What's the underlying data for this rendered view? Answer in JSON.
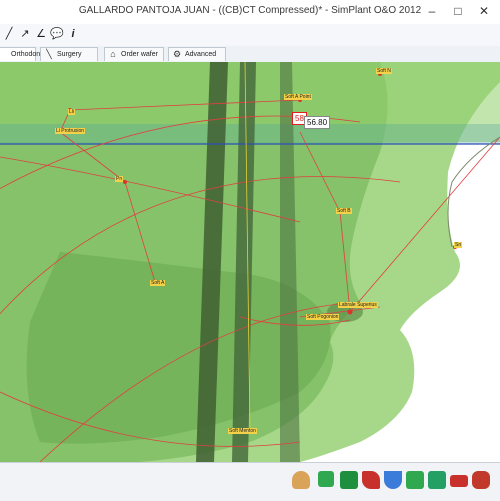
{
  "window": {
    "title": "GALLARDO PANTOJA JUAN -   ((CB)CT Compressed)* - SimPlant O&O 2012",
    "min_glyph": "–",
    "max_glyph": "□",
    "close_glyph": "✕"
  },
  "toolbar": {
    "icons": [
      "zoom-icon",
      "line-tool-icon",
      "angle-tool-icon",
      "comment-icon",
      "info-icon"
    ],
    "glyphs": [
      "╱",
      "↗",
      "∠",
      "💬",
      "i"
    ]
  },
  "tabs": [
    {
      "label": "Orthodontics",
      "icon": "orthodontics-icon",
      "glyph": "▣",
      "active": true
    },
    {
      "label": "Surgery",
      "icon": "scalpel-icon",
      "glyph": "╲",
      "active": false
    },
    {
      "label": "Order wafer",
      "icon": "cart-icon",
      "glyph": "⌂",
      "active": false
    },
    {
      "label": "Advanced",
      "icon": "gear-icon",
      "glyph": "⚙",
      "active": false
    }
  ],
  "viewport": {
    "measurement_top": "56.80",
    "measurement_red": "58",
    "landmarks": [
      "Lli",
      "Li Protrusion",
      "Soft B",
      "Soft Pogonion",
      "Soft Menton",
      "Soft N",
      "Soft A",
      "Pn",
      "Sn",
      "Soft A Point",
      "Labrale Superius"
    ]
  },
  "statusbar": {
    "icons": [
      "skull-view-icon",
      "soft-tissue-icon",
      "maxilla-icon",
      "mandible-icon",
      "dentition-icon",
      "teeth-upper-icon",
      "teeth-lower-icon",
      "nerve-icon",
      "jaw-icon"
    ],
    "colors": [
      "#d9a35a",
      "#2fa84f",
      "#1e8f3c",
      "#c8312b",
      "#3b7bd9",
      "#2fa84f",
      "#25a065",
      "#c8312b",
      "#c0392b"
    ]
  },
  "colors": {
    "soft_tissue": "#9fd47f",
    "bone": "#6fae55",
    "measure_line": "#e04040",
    "axis_line": "#2e4fb8",
    "landmark_bg": "#f3d24a"
  }
}
